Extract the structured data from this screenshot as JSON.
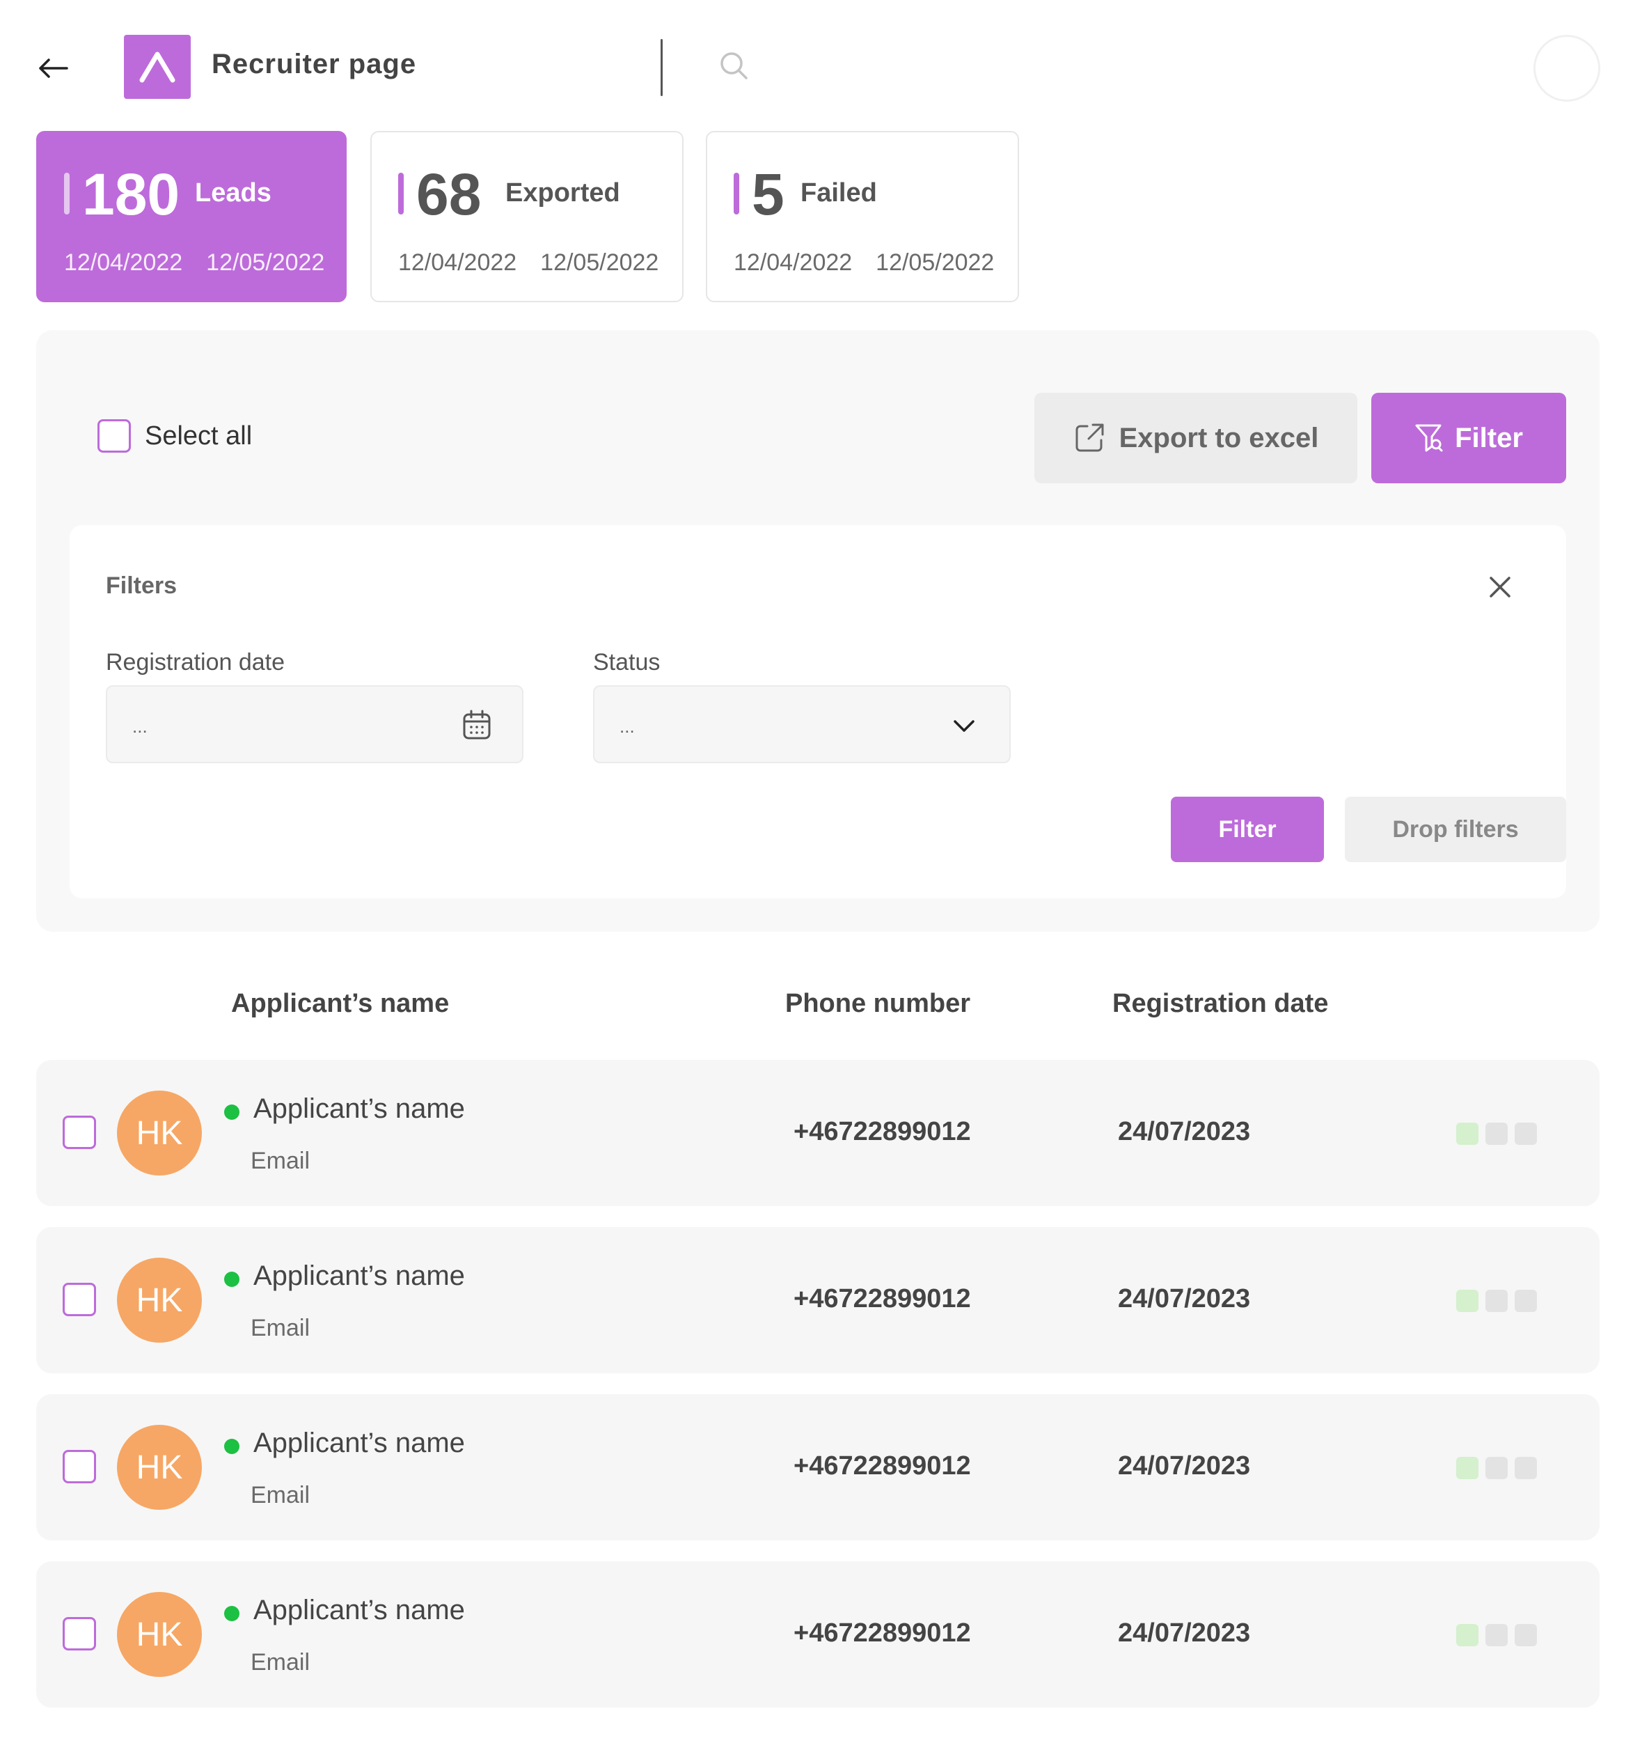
{
  "header": {
    "back_icon": "arrow-left-icon",
    "logo_icon": "a-logo-icon",
    "title": "Recruiter page",
    "search_icon": "search-icon",
    "avatar": ""
  },
  "stats": [
    {
      "value": "180",
      "label": "Leads",
      "from": "12/04/2022",
      "to": "12/05/2022",
      "active": true
    },
    {
      "value": "68",
      "label": "Exported",
      "from": "12/04/2022",
      "to": "12/05/2022",
      "active": false
    },
    {
      "value": "5",
      "label": "Failed",
      "from": "12/04/2022",
      "to": "12/05/2022",
      "active": false
    }
  ],
  "toolbar": {
    "select_all_label": "Select all",
    "export_label": "Export to excel",
    "export_icon": "external-link-icon",
    "filter_label": "Filter",
    "filter_icon": "filter-icon"
  },
  "filters": {
    "title": "Filters",
    "close_icon": "close-icon",
    "registration_date_label": "Registration date",
    "registration_date_value": "...",
    "calendar_icon": "calendar-icon",
    "status_label": "Status",
    "status_value": "...",
    "chevron_icon": "chevron-down-icon",
    "apply_label": "Filter",
    "drop_label": "Drop filters"
  },
  "table": {
    "headers": {
      "name": "Applicant’s name",
      "phone": "Phone number",
      "date": "Registration date"
    },
    "rows": [
      {
        "initials": "HK",
        "name": "Applicant’s name",
        "email": "Email",
        "phone": "+46722899012",
        "date": "24/07/2023"
      },
      {
        "initials": "HK",
        "name": "Applicant’s name",
        "email": "Email",
        "phone": "+46722899012",
        "date": "24/07/2023"
      },
      {
        "initials": "HK",
        "name": "Applicant’s name",
        "email": "Email",
        "phone": "+46722899012",
        "date": "24/07/2023"
      },
      {
        "initials": "HK",
        "name": "Applicant’s name",
        "email": "Email",
        "phone": "+46722899012",
        "date": "24/07/2023"
      }
    ]
  },
  "colors": {
    "accent": "#bd6bda",
    "avatar": "#f6a765",
    "online": "#1cc042",
    "action_green": "#d4f0cd",
    "action_gray": "#e3e3e3"
  }
}
